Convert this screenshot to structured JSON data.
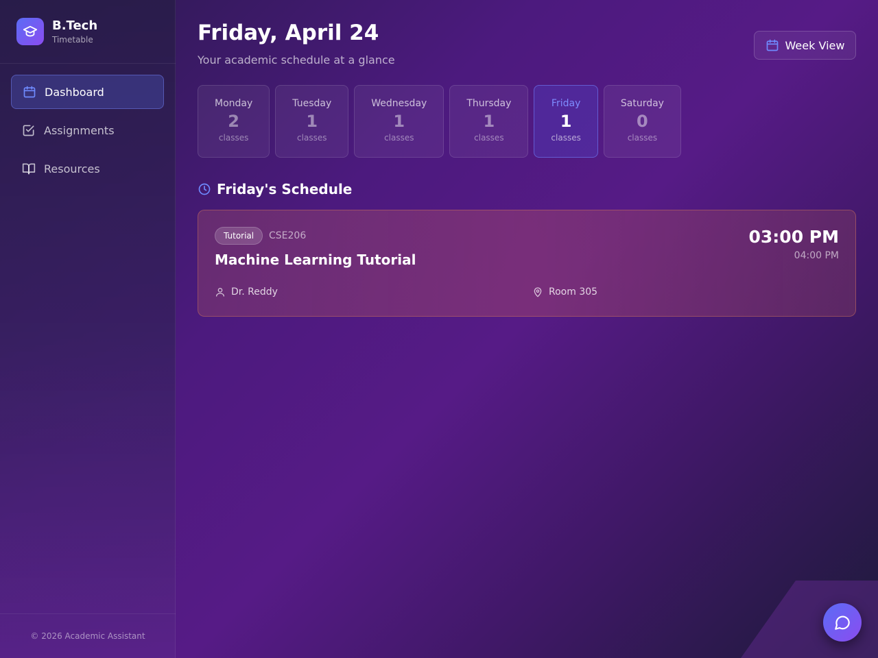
{
  "brand": {
    "title": "B.Tech",
    "subtitle": "Timetable",
    "icon": "graduation-cap-icon"
  },
  "nav": {
    "items": [
      {
        "label": "Dashboard",
        "icon": "calendar-icon",
        "active": true
      },
      {
        "label": "Assignments",
        "icon": "checkbox-icon",
        "active": false
      },
      {
        "label": "Resources",
        "icon": "book-open-icon",
        "active": false
      }
    ]
  },
  "footer": {
    "text": "© 2026 Academic Assistant"
  },
  "header": {
    "title": "Friday, April 24",
    "subtitle": "Your academic schedule at a glance",
    "week_view_label": "Week View"
  },
  "days": [
    {
      "name": "Monday",
      "count": "2",
      "unit": "classes",
      "active": false
    },
    {
      "name": "Tuesday",
      "count": "1",
      "unit": "classes",
      "active": false
    },
    {
      "name": "Wednesday",
      "count": "1",
      "unit": "classes",
      "active": false
    },
    {
      "name": "Thursday",
      "count": "1",
      "unit": "classes",
      "active": false
    },
    {
      "name": "Friday",
      "count": "1",
      "unit": "classes",
      "active": true
    },
    {
      "name": "Saturday",
      "count": "0",
      "unit": "classes",
      "active": false
    }
  ],
  "schedule": {
    "title": "Friday's Schedule",
    "classes": [
      {
        "type": "Tutorial",
        "code": "CSE206",
        "title": "Machine Learning Tutorial",
        "start": "03:00 PM",
        "end": "04:00 PM",
        "instructor": "Dr. Reddy",
        "room": "Room 305"
      }
    ]
  },
  "colors": {
    "accent": "#5b6cf5",
    "accent_secondary": "#8b4cf0",
    "active_day_text": "#7e8cff",
    "card_border": "#d2785a"
  }
}
